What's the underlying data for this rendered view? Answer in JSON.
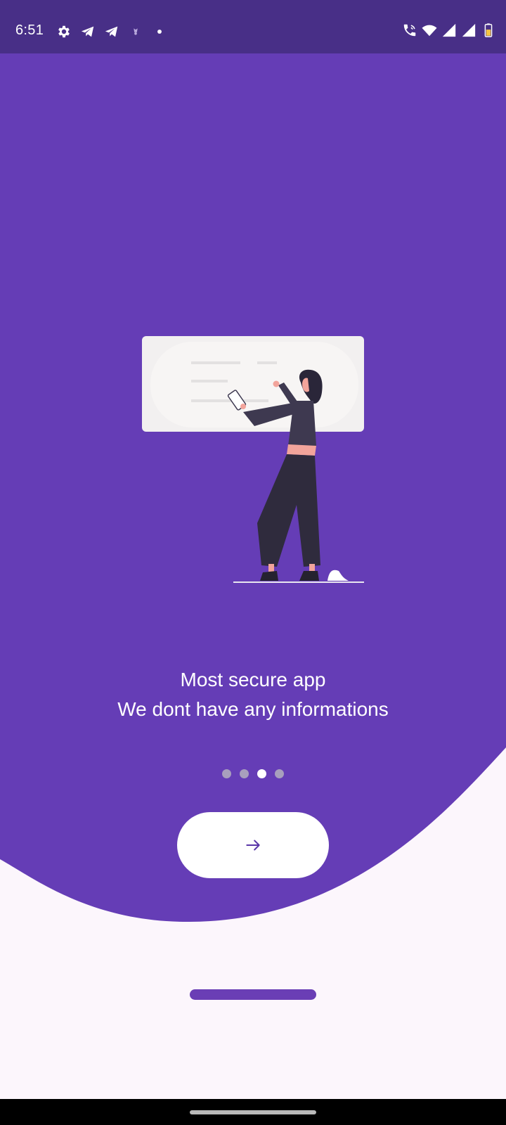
{
  "status_bar": {
    "time": "6:51",
    "left_icons": [
      "gear-icon",
      "telegram-icon",
      "telegram-icon",
      "app-notification-icon",
      "dot-icon"
    ],
    "right_icons": [
      "wifi-calling-icon",
      "wifi-icon",
      "signal-icon",
      "signal-icon",
      "battery-icon"
    ]
  },
  "onboarding": {
    "title": "Most secure app",
    "subtitle": "We dont have any informations",
    "page_count": 4,
    "active_page": 3,
    "next_icon": "arrow-right-icon"
  },
  "colors": {
    "status_bar": "#482f87",
    "primary_purple": "#653db6",
    "background": "#fcf6fc",
    "dot_inactive": "#a89fbd",
    "dot_active": "#ffffff"
  }
}
